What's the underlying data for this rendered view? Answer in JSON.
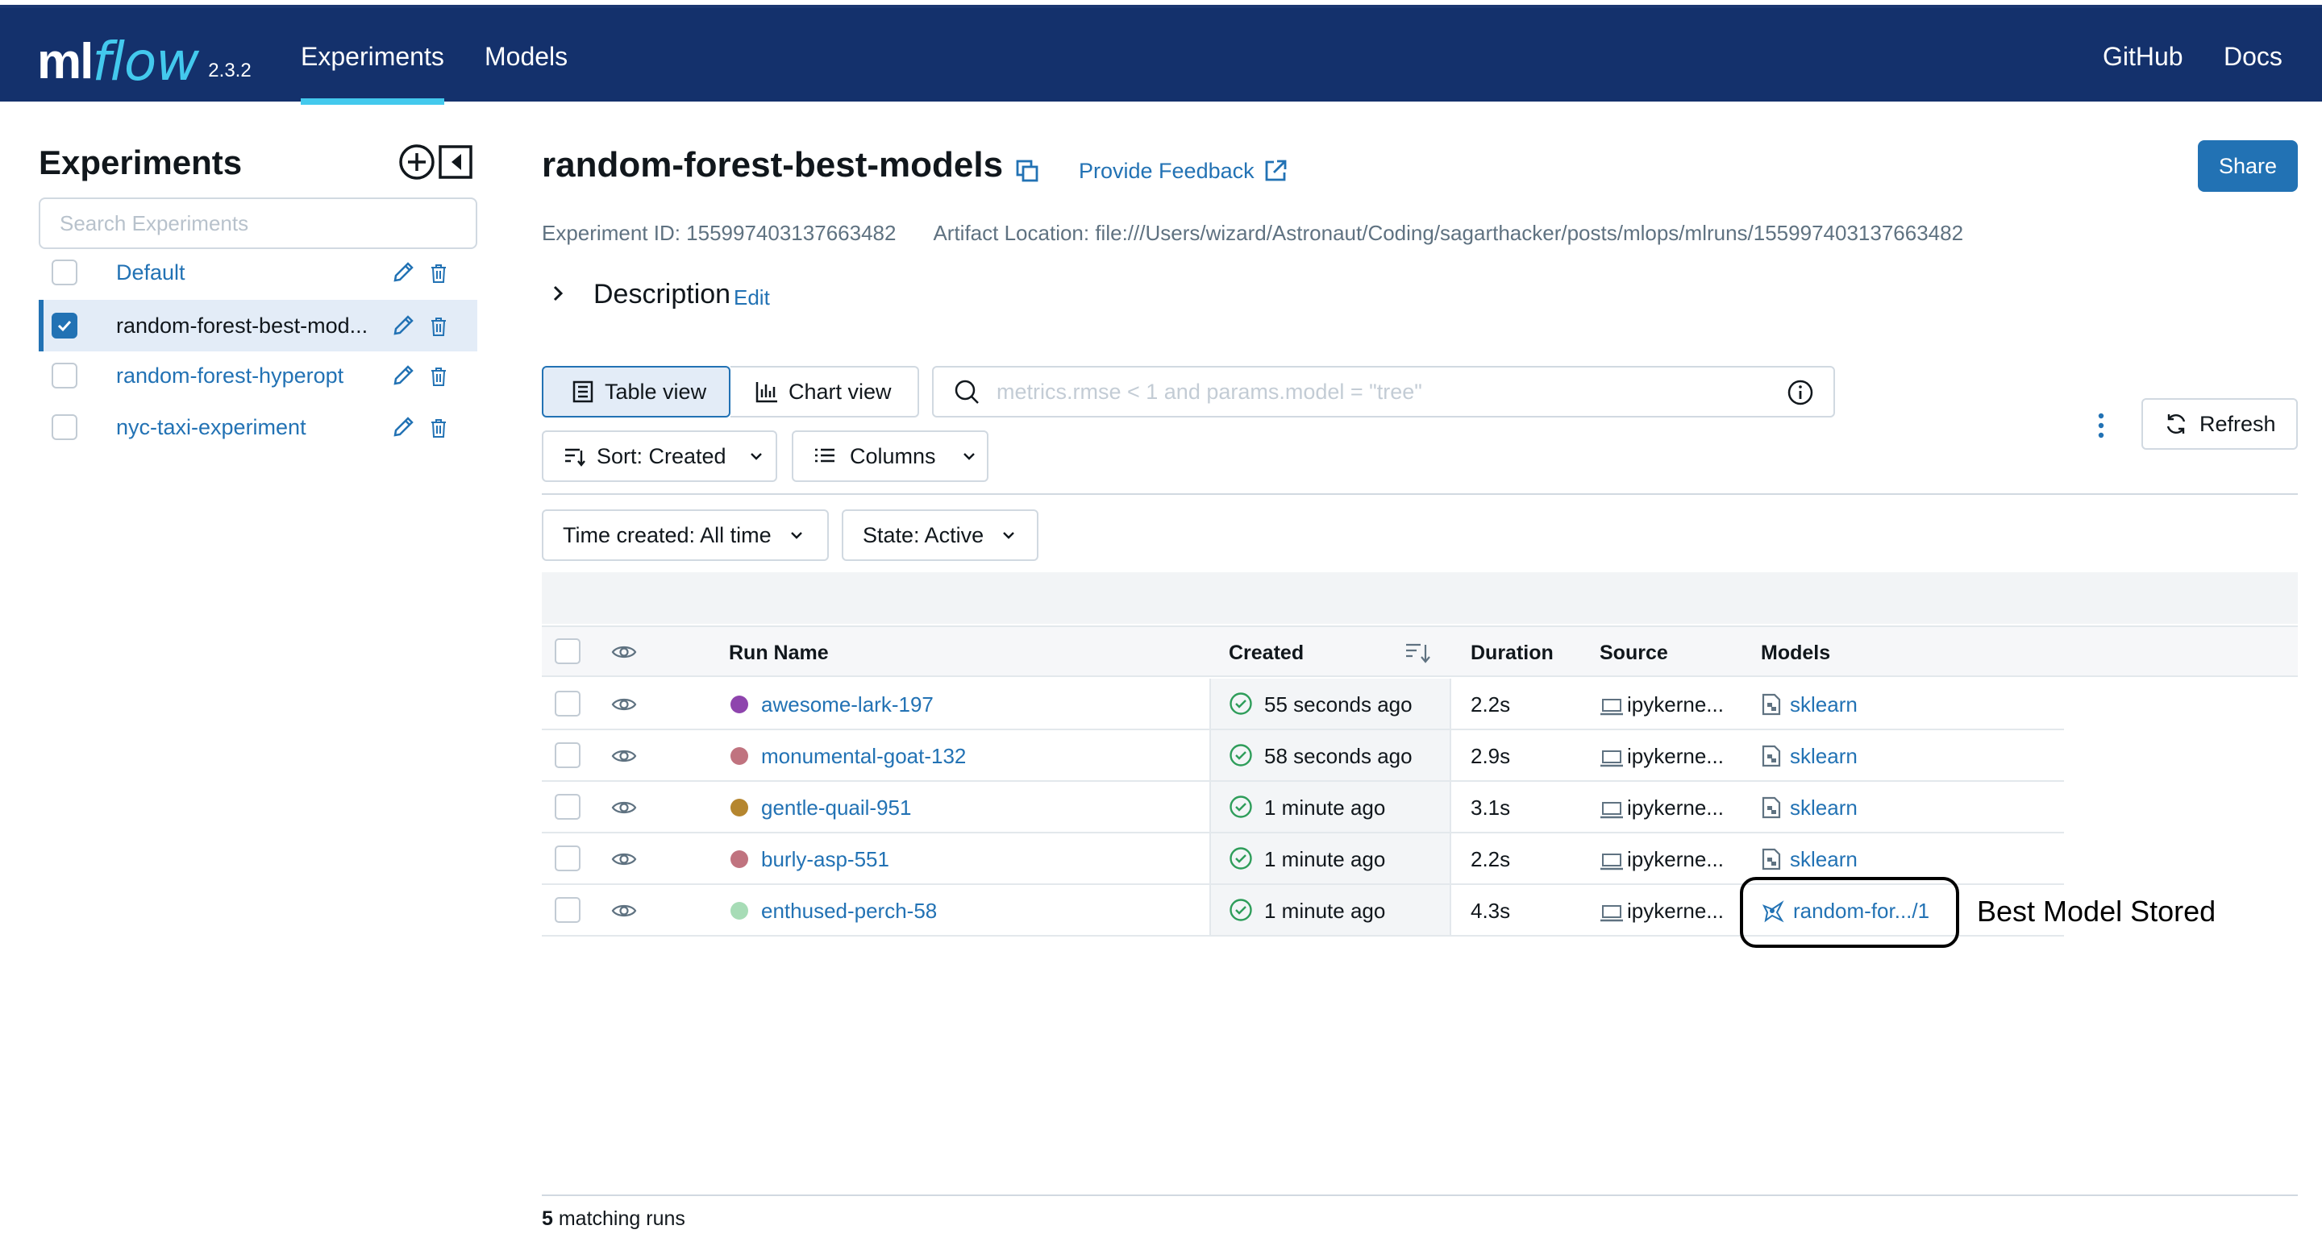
{
  "header": {
    "logo_ml": "ml",
    "logo_flow": "flow",
    "version": "2.3.2",
    "nav": {
      "experiments": "Experiments",
      "models": "Models",
      "github": "GitHub",
      "docs": "Docs"
    }
  },
  "sidebar": {
    "title": "Experiments",
    "search_placeholder": "Search Experiments",
    "items": [
      {
        "label": "Default",
        "selected": false
      },
      {
        "label": "random-forest-best-mod...",
        "selected": true
      },
      {
        "label": "random-forest-hyperopt",
        "selected": false
      },
      {
        "label": "nyc-taxi-experiment",
        "selected": false
      }
    ]
  },
  "experiment": {
    "title": "random-forest-best-models",
    "feedback": "Provide Feedback",
    "share": "Share",
    "id_text": "Experiment ID: 155997403137663482",
    "artifact_text": "Artifact Location: file:///Users/wizard/Astronaut/Coding/sagarthacker/posts/mlops/mlruns/155997403137663482",
    "description": "Description",
    "edit": "Edit"
  },
  "controls": {
    "table_view": "Table view",
    "chart_view": "Chart view",
    "search_placeholder": "metrics.rmse < 1 and params.model = \"tree\"",
    "refresh": "Refresh",
    "sort": "Sort: Created",
    "columns": "Columns",
    "time_filter": "Time created: All time",
    "state_filter": "State: Active"
  },
  "table": {
    "columns": {
      "run_name": "Run Name",
      "created": "Created",
      "duration": "Duration",
      "source": "Source",
      "models": "Models"
    },
    "rows": [
      {
        "name": "awesome-lark-197",
        "color": "#8e44ad",
        "created": "55 seconds ago",
        "duration": "2.2s",
        "source": "ipykerne...",
        "model": "sklearn"
      },
      {
        "name": "monumental-goat-132",
        "color": "#c0737f",
        "created": "58 seconds ago",
        "duration": "2.9s",
        "source": "ipykerne...",
        "model": "sklearn"
      },
      {
        "name": "gentle-quail-951",
        "color": "#b5862f",
        "created": "1 minute ago",
        "duration": "3.1s",
        "source": "ipykerne...",
        "model": "sklearn"
      },
      {
        "name": "burly-asp-551",
        "color": "#c0737f",
        "created": "1 minute ago",
        "duration": "2.2s",
        "source": "ipykerne...",
        "model": "sklearn"
      },
      {
        "name": "enthused-perch-58",
        "color": "#a7dcb6",
        "created": "1 minute ago",
        "duration": "4.3s",
        "source": "ipykerne...",
        "model": "random-for.../1"
      }
    ]
  },
  "annotation": "Best Model Stored",
  "footer": {
    "count": "5",
    "suffix": " matching runs"
  },
  "colors": {
    "brand": "#14316c",
    "accent": "#43c9ed",
    "link": "#2272b4",
    "success": "#2e9d5a"
  }
}
